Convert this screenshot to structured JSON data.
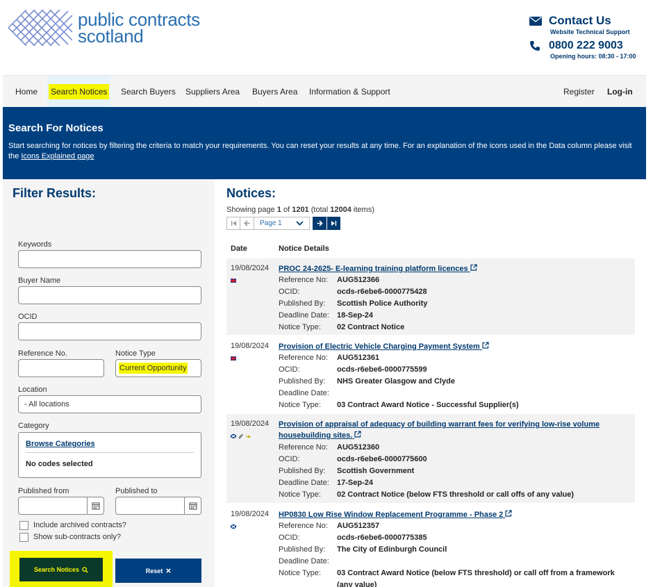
{
  "header": {
    "brand_line1": "public contracts",
    "brand_line2": "scotland",
    "contact_title": "Contact Us",
    "contact_sub": "Website Technical Support",
    "phone": "0800 222 9003",
    "hours": "Opening hours: 08:30 - 17:00"
  },
  "nav": {
    "home": "Home",
    "search_notices": "Search Notices",
    "search_buyers": "Search Buyers",
    "suppliers_area": "Suppliers Area",
    "buyers_area": "Buyers Area",
    "info_support": "Information & Support",
    "register": "Register",
    "login": "Log-in"
  },
  "banner": {
    "title": "Search For Notices",
    "text": "Start searching for notices by filtering the criteria to match your requirements. You can reset your results at any time. For an explanation of the icons used in the Data column please visit the ",
    "link": "Icons Explained page"
  },
  "filter": {
    "title": "Filter Results:",
    "keywords_label": "Keywords",
    "buyer_label": "Buyer Name",
    "ocid_label": "OCID",
    "ref_label": "Reference No.",
    "notice_type_label": "Notice Type",
    "notice_type_value": "Current Opportunity",
    "location_label": "Location",
    "location_value": "- All locations",
    "category_label": "Category",
    "browse_categories": "Browse Categories",
    "no_codes": "No codes selected",
    "published_from": "Published from",
    "published_to": "Published to",
    "archived": "Include archived contracts?",
    "subcontracts": "Show sub-contracts only?",
    "search_button": "Search Notices",
    "reset_button": "Reset"
  },
  "results": {
    "title": "Notices:",
    "showing_prefix": "Showing page ",
    "page": "1",
    "of": " of ",
    "total_pages": "1201",
    "total_prefix": " (total ",
    "total_items": "12004",
    "total_suffix": " items)",
    "page_select": "Page 1",
    "col_date": "Date",
    "col_details": "Notice Details"
  },
  "notices": [
    {
      "date": "19/08/2024",
      "title": "PROC 24-2625- E-learning training platform licences",
      "ref": "AUG512366",
      "ocid": "ocds-r6ebe6-0000775428",
      "published_by": "Scottish Police Authority",
      "deadline": "18-Sep-24",
      "type": "02 Contract Notice"
    },
    {
      "date": "19/08/2024",
      "title": "Provision of Electric Vehicle Charging Payment System",
      "ref": "AUG512361",
      "ocid": "ocds-r6ebe6-0000775599",
      "published_by": "NHS Greater Glasgow and Clyde",
      "deadline": "",
      "type": "03 Contract Award Notice - Successful Supplier(s)"
    },
    {
      "date": "19/08/2024",
      "title": "Provision of appraisal of adequacy of building warrant fees for verifying low-rise volume housebuilding sites.",
      "ref": "AUG512360",
      "ocid": "ocds-r6ebe6-0000775600",
      "published_by": "Scottish Government",
      "deadline": "17-Sep-24",
      "type": "02 Contract Notice (below FTS threshold or call offs of any value)"
    },
    {
      "date": "19/08/2024",
      "title": "HP0830 Low Rise Window Replacement Programme - Phase 2",
      "ref": "AUG512357",
      "ocid": "ocds-r6ebe6-0000775385",
      "published_by": "The City of Edinburgh Council",
      "deadline": "",
      "type": "03 Contract Award Notice (below FTS threshold) or call off from a framework (any value)"
    }
  ],
  "field_labels": {
    "ref": "Reference No:",
    "ocid": "OCID:",
    "published_by": "Published By:",
    "deadline": "Deadline Date:",
    "type": "Notice Type:"
  }
}
